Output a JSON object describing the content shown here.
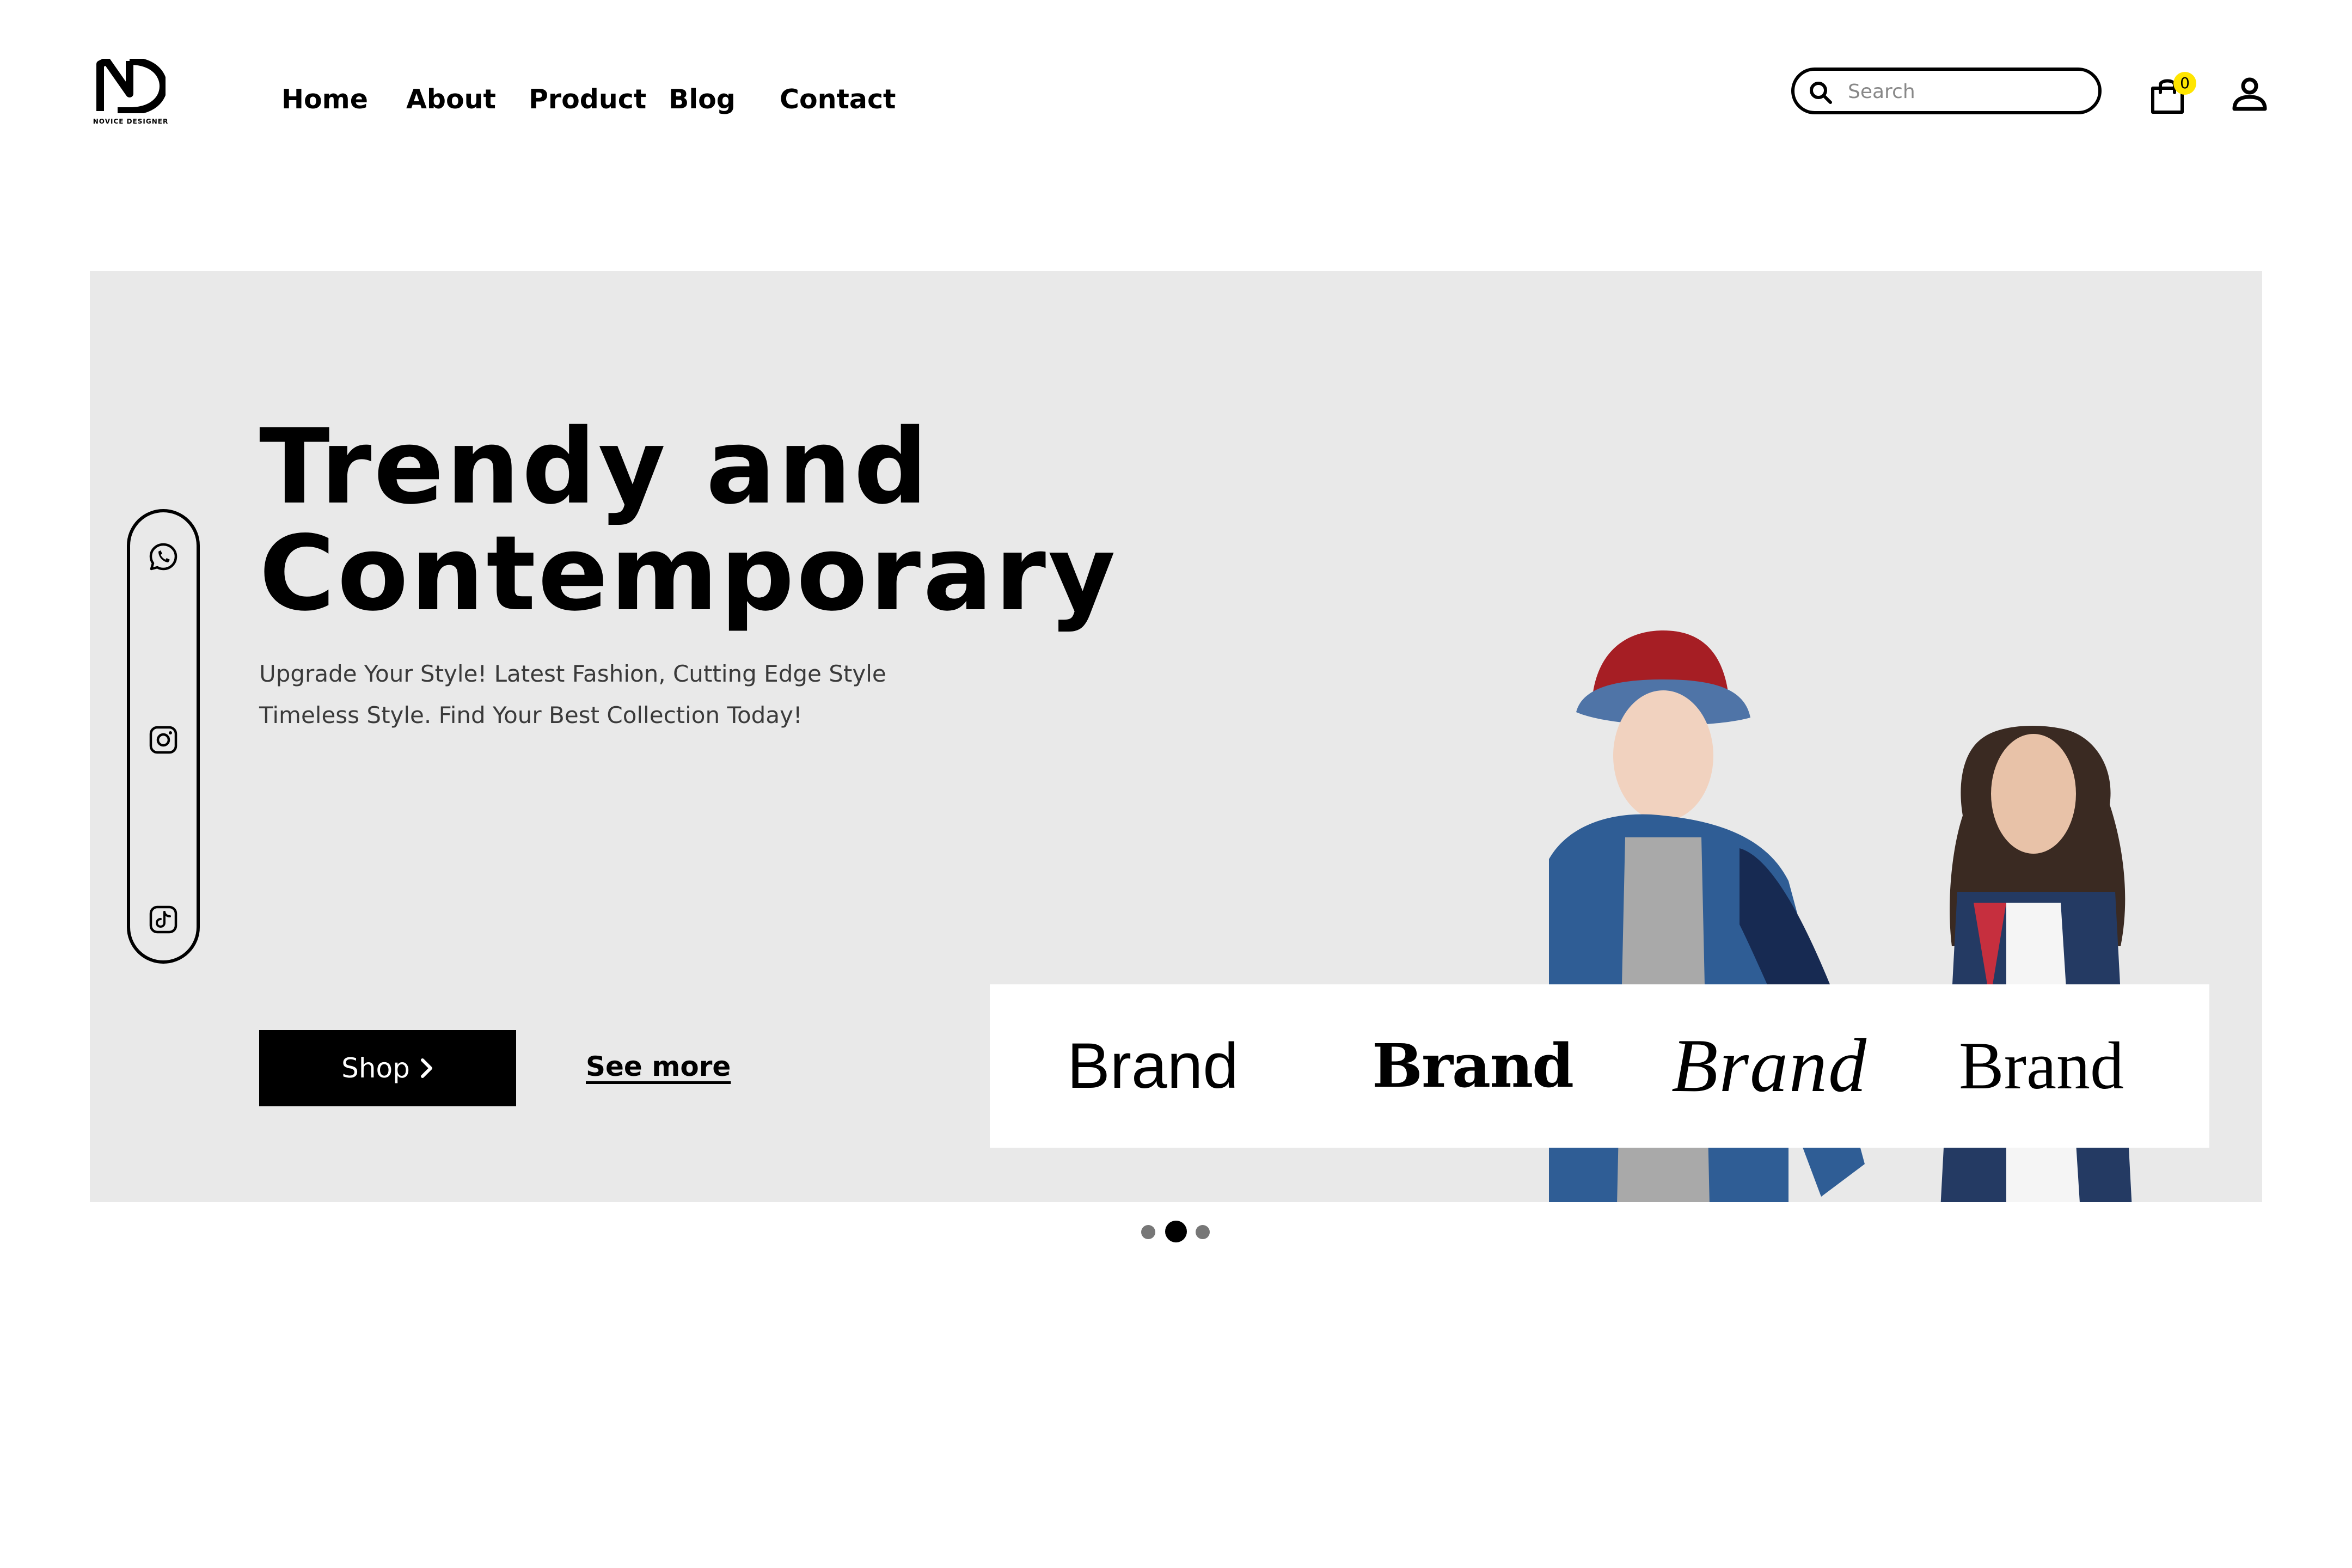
{
  "header": {
    "logo_text": "NOVICE DESIGNER",
    "nav": [
      {
        "label": "Home"
      },
      {
        "label": "About"
      },
      {
        "label": "Product"
      },
      {
        "label": "Blog"
      },
      {
        "label": "Contact"
      }
    ],
    "search": {
      "placeholder": "Search",
      "value": "",
      "icon": "search-icon"
    },
    "cart": {
      "count": "0",
      "icon": "shopping-bag-icon",
      "badge_color": "#ffe500"
    },
    "user_icon": "user-icon"
  },
  "hero": {
    "title_line1": "Trendy and",
    "title_line2": "Contemporary",
    "subtitle_line1": "Upgrade Your Style! Latest Fashion, Cutting Edge Style",
    "subtitle_line2": "Timeless Style. Find Your Best Collection Today!",
    "shop_label": "Shop",
    "see_more_label": "See more",
    "background": "#e9e9e9",
    "social": [
      "whatsapp-icon",
      "instagram-icon",
      "tiktok-icon"
    ]
  },
  "brands": [
    {
      "label": "Brand"
    },
    {
      "label": "Brand"
    },
    {
      "label": "Brand"
    },
    {
      "label": "Brand"
    }
  ],
  "carousel": {
    "slide_count": 3,
    "active_slide": 2
  },
  "colors": {
    "primary": "#000000",
    "accent": "#ffe500",
    "hero_bg": "#e9e9e9"
  }
}
